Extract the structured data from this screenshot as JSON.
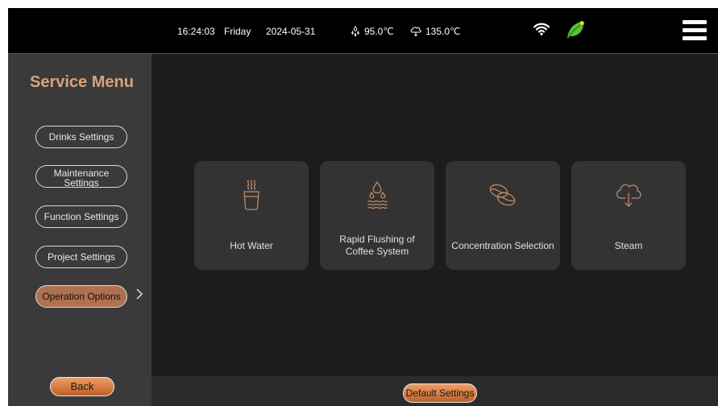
{
  "status_bar": {
    "time": "16:24:03",
    "day": "Friday",
    "date": "2024-05-31",
    "water_temp": "95.0℃",
    "steam_temp": "135.0℃",
    "icons": [
      "water-temp-icon",
      "steam-temp-icon",
      "wifi-icon",
      "eco-leaf-icon",
      "menu-icon"
    ]
  },
  "sidebar": {
    "title": "Service Menu",
    "items": [
      {
        "label": "Drinks Settings"
      },
      {
        "label_line1": "Maintenance",
        "label_line2": "Settings"
      },
      {
        "label": "Function Settings"
      },
      {
        "label": "Project Settings"
      },
      {
        "label": "Operation Options",
        "active": true
      }
    ],
    "back_label": "Back"
  },
  "cards": [
    {
      "label": "Hot Water",
      "icon": "hot-water-cup-icon"
    },
    {
      "label": "Rapid Flushing of Coffee System",
      "icon": "flushing-drops-icon"
    },
    {
      "label": "Concentration Selection",
      "icon": "coffee-beans-icon"
    },
    {
      "label": "Steam",
      "icon": "steam-cloud-icon"
    }
  ],
  "bottom_bar": {
    "default_label": "Default Settings"
  },
  "colors": {
    "accent": "#b07152",
    "title": "#d8a27c",
    "button_orange": "#d67a3f",
    "eco_green": "#5bc236",
    "card_bg": "#333333",
    "icon_stroke": "#bf8a68"
  }
}
